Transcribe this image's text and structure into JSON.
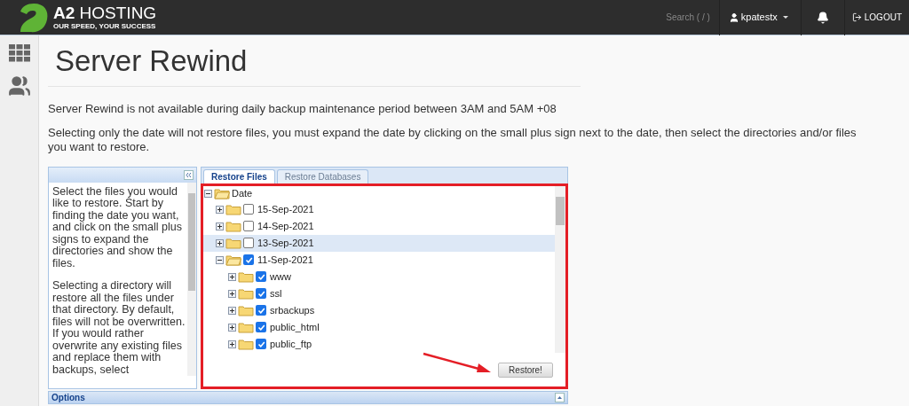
{
  "header": {
    "logo_title": "**A2** HOSTING",
    "logo_tagline": "OUR SPEED, YOUR SUCCESS",
    "search": {
      "placeholder": "Search ( / )"
    },
    "user": "kpatestx",
    "logout": "LOGOUT"
  },
  "title": "Server Rewind",
  "notices": [
    "Server Rewind is not available during daily backup maintenance period between 3AM and 5AM +08",
    "Selecting only the date will not restore files, you must expand the date by clicking on the small plus sign next to the date, then select the directories and/or files you want to restore."
  ],
  "help_text": [
    "Select the files you would like to restore. Start by finding the date you want, and click on the small plus signs to expand the directories and show the files.",
    "Selecting a directory will restore all the files under that directory. By default, files will not be overwritten. If you would rather overwrite any existing files and replace them with backups, select"
  ],
  "tabs": [
    {
      "label": "Restore Files",
      "selected": true
    },
    {
      "label": "Restore Databases",
      "selected": false
    }
  ],
  "tree": {
    "label": "Date",
    "expanded": true,
    "children": [
      {
        "label": "15-Sep-2021",
        "checked": false,
        "expanded": false,
        "selected": false
      },
      {
        "label": "14-Sep-2021",
        "checked": false,
        "expanded": false,
        "selected": false
      },
      {
        "label": "13-Sep-2021",
        "checked": false,
        "expanded": false,
        "selected": true
      },
      {
        "label": "11-Sep-2021",
        "checked": true,
        "expanded": true,
        "selected": false,
        "children": [
          {
            "label": "www",
            "checked": true,
            "expanded": false,
            "selected": false
          },
          {
            "label": "ssl",
            "checked": true,
            "expanded": false,
            "selected": false
          },
          {
            "label": "srbackups",
            "checked": true,
            "expanded": false,
            "selected": false
          },
          {
            "label": "public_html",
            "checked": true,
            "expanded": false,
            "selected": false
          },
          {
            "label": "public_ftp",
            "checked": true,
            "expanded": false,
            "selected": false
          }
        ]
      }
    ]
  },
  "restore_button": "Restore!",
  "options_title": "Options"
}
